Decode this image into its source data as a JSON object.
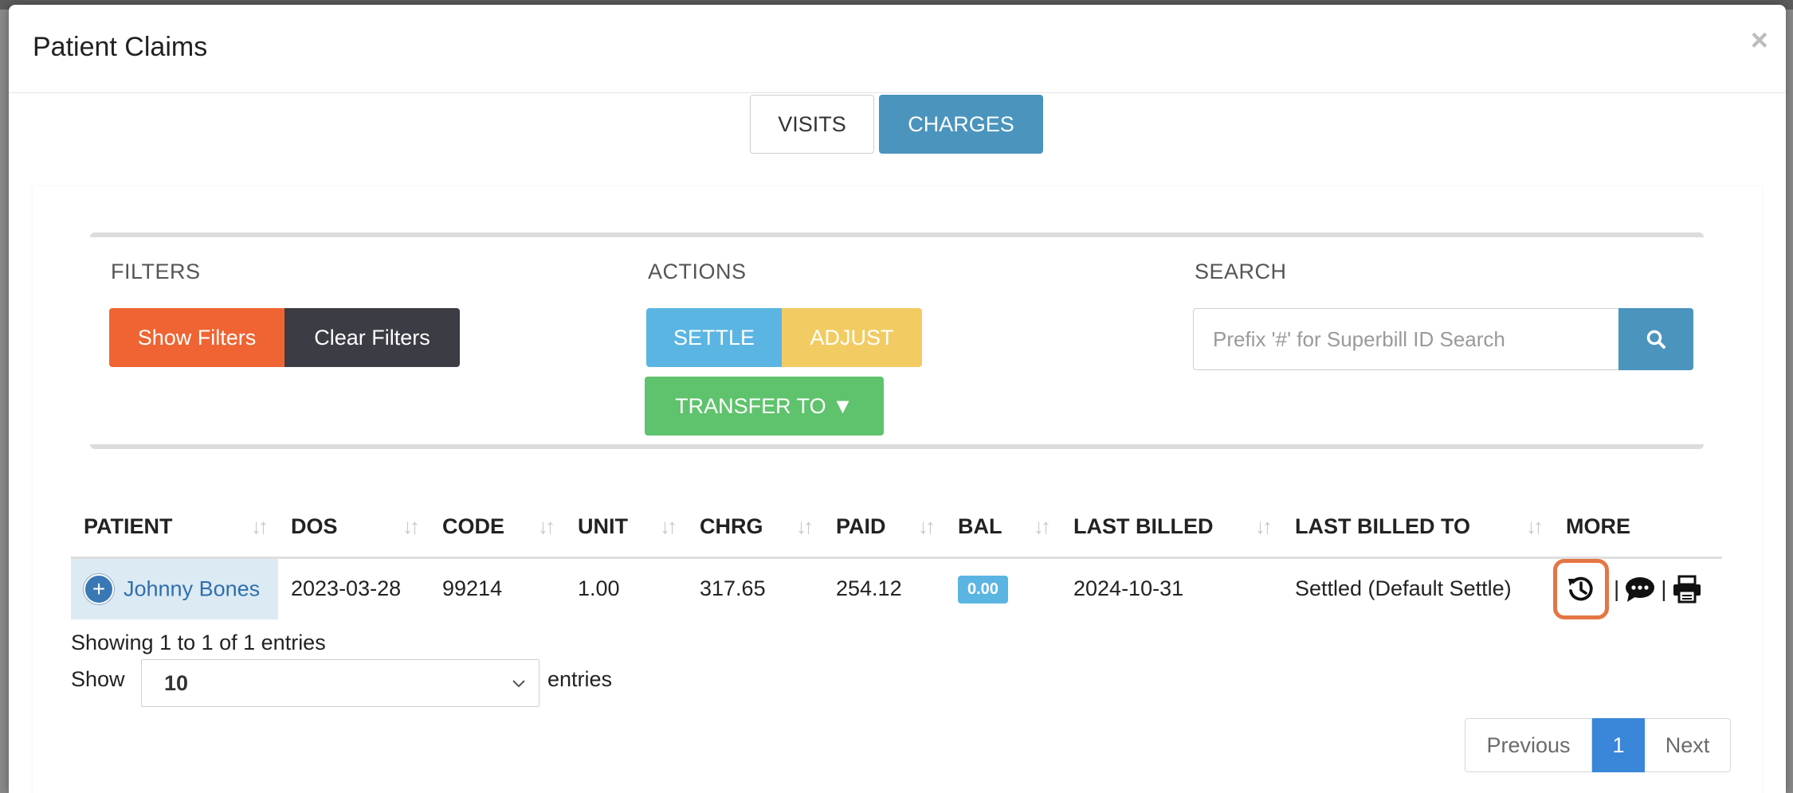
{
  "modal": {
    "title": "Patient Claims",
    "close_glyph": "×"
  },
  "tabs": [
    {
      "label": "VISITS",
      "active": false
    },
    {
      "label": "CHARGES",
      "active": true
    }
  ],
  "filters": {
    "label": "FILTERS",
    "show_label": "Show Filters",
    "clear_label": "Clear Filters"
  },
  "actions": {
    "label": "ACTIONS",
    "settle_label": "SETTLE",
    "adjust_label": "ADJUST",
    "transfer_label": "TRANSFER TO ▼"
  },
  "search": {
    "label": "SEARCH",
    "placeholder": "Prefix '#' for Superbill ID Search",
    "value": ""
  },
  "table": {
    "columns": [
      "PATIENT",
      "DOS",
      "CODE",
      "UNIT",
      "CHRG",
      "PAID",
      "BAL",
      "LAST BILLED",
      "LAST BILLED TO",
      "MORE"
    ],
    "sort_glyph": "↓↑",
    "rows": [
      {
        "expand_glyph": "+",
        "patient": "Johnny Bones",
        "dos": "2023-03-28",
        "code": "99214",
        "unit": "1.00",
        "chrg": "317.65",
        "paid": "254.12",
        "bal": "0.00",
        "last_billed": "2024-10-31",
        "last_billed_to": "Settled (Default Settle)",
        "separator": "|"
      }
    ]
  },
  "footer": {
    "info": "Showing 1 to 1 of 1 entries",
    "show_label": "Show",
    "page_size": "10",
    "entries_label": "entries"
  },
  "pagination": {
    "previous": "Previous",
    "current": "1",
    "next": "Next"
  },
  "colors": {
    "show_filters": "#ef6432",
    "clear_filters": "#3c3c45",
    "settle": "#5bb5e3",
    "adjust": "#f2cc62",
    "transfer": "#5ec36c",
    "primary": "#4a94be",
    "highlight_ring": "#e47645",
    "page_active": "#3a86d9"
  }
}
